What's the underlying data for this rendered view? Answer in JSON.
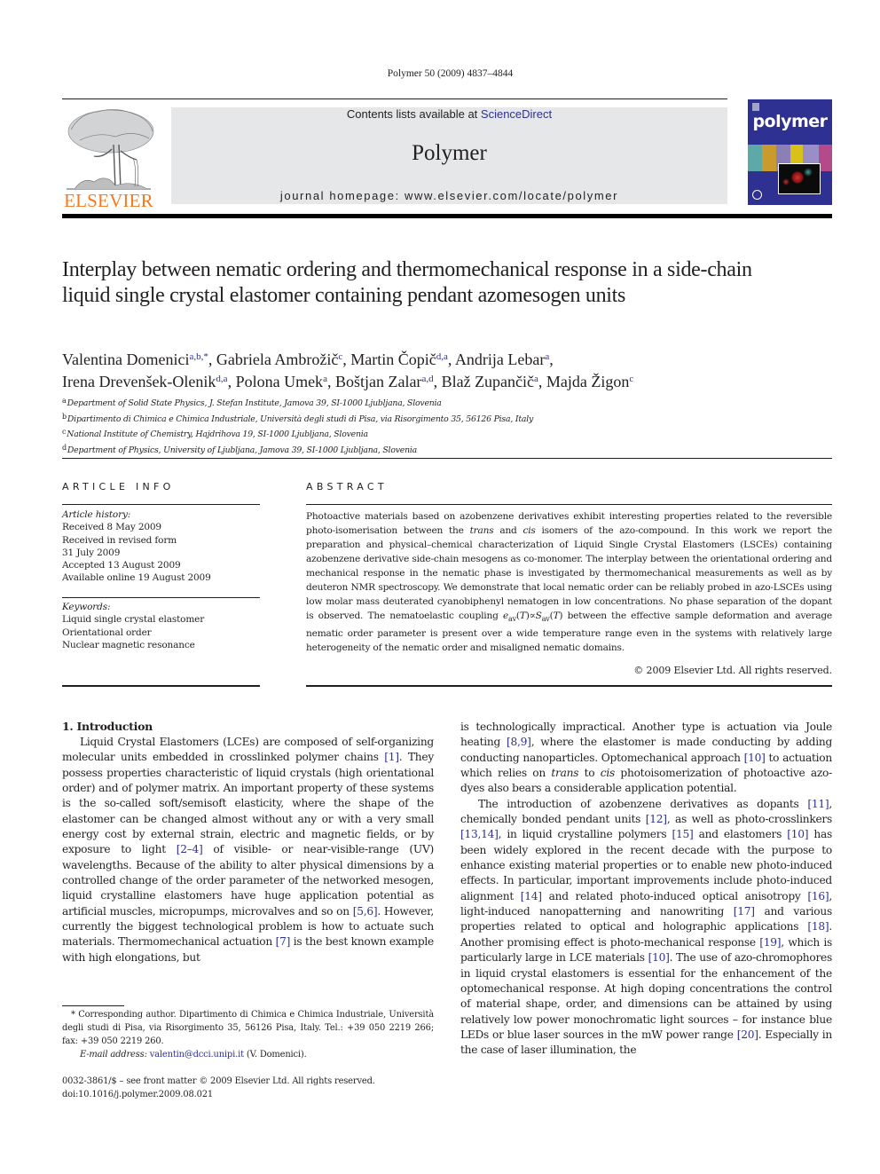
{
  "header": {
    "citation": "Polymer 50 (2009) 4837–4844",
    "contents_prefix": "Contents lists available at ",
    "contents_link": "ScienceDirect",
    "journal_name": "Polymer",
    "homepage": "journal homepage: www.elsevier.com/locate/polymer",
    "publisher_logo_text": "ELSEVIER",
    "cover_title": "polymer"
  },
  "colors": {
    "link": "#2e3192",
    "elsevier_orange": "#f47920",
    "banner_gray": "#e6e7e8",
    "cover_blue": "#2e3192"
  },
  "article": {
    "title": "Interplay between nematic ordering and thermomechanical response in a side-chain liquid single crystal elastomer containing pendant azomesogen units",
    "authors": [
      {
        "name": "Valentina Domenici",
        "aff": "a,b,*"
      },
      {
        "name": "Gabriela Ambrožič",
        "aff": "c"
      },
      {
        "name": "Martin Čopič",
        "aff": "d,a"
      },
      {
        "name": "Andrija Lebar",
        "aff": "a"
      },
      {
        "name": "Irena Drevenšek-Olenik",
        "aff": "d,a"
      },
      {
        "name": "Polona Umek",
        "aff": "a"
      },
      {
        "name": "Boštjan Zalar",
        "aff": "a,d"
      },
      {
        "name": "Blaž Zupančič",
        "aff": "a"
      },
      {
        "name": "Majda Žigon",
        "aff": "c"
      }
    ],
    "affiliations": [
      {
        "key": "a",
        "text": "Department of Solid State Physics, J. Stefan Institute, Jamova 39, SI-1000 Ljubljana, Slovenia"
      },
      {
        "key": "b",
        "text": "Dipartimento di Chimica e Chimica Industriale, Università degli studi di Pisa, via Risorgimento 35, 56126 Pisa, Italy"
      },
      {
        "key": "c",
        "text": "National Institute of Chemistry, Hajdrihova 19, SI-1000 Ljubljana, Slovenia"
      },
      {
        "key": "d",
        "text": "Department of Physics, University of Ljubljana, Jamova 39, SI-1000 Ljubljana, Slovenia"
      }
    ]
  },
  "article_info": {
    "heading": "ARTICLE INFO",
    "history_label": "Article history:",
    "history": [
      "Received 8 May 2009",
      "Received in revised form",
      "31 July 2009",
      "Accepted 13 August 2009",
      "Available online 19 August 2009"
    ],
    "keywords_label": "Keywords:",
    "keywords": [
      "Liquid single crystal elastomer",
      "Orientational order",
      "Nuclear magnetic resonance"
    ]
  },
  "abstract": {
    "heading": "ABSTRACT",
    "p1": "Photoactive materials based on azobenzene derivatives exhibit interesting properties related to the reversible photo-isomerisation between the ",
    "trans": "trans",
    "p2": " and ",
    "cis": "cis",
    "p3": " isomers of the azo-compound. In this work we report the preparation and physical–chemical characterization of Liquid Single Crystal Elastomers (LSCEs) containing azobenzene derivative side-chain mesogens as co-monomer. The interplay between the orientational ordering and mechanical response in the nematic phase is investigated by thermomechanical measurements as well as by deuteron NMR spectroscopy. We demonstrate that local nematic order can be reliably probed in azo-LSCEs using low molar mass deuterated cyanobiphenyl nematogen in low concentrations. No phase separation of the dopant is observed. The nematoelastic coupling ",
    "formula": "e_av(T) ∝ S_av(T)",
    "p4": " between the effective sample deformation and average nematic order parameter is present over a wide temperature range even in the systems with relatively large heterogeneity of the nematic order and misaligned nematic domains.",
    "copyright": "© 2009 Elsevier Ltd. All rights reserved."
  },
  "introduction": {
    "heading": "1.  Introduction",
    "left": [
      {
        "t": "Liquid Crystal Elastomers (LCEs) are composed of self-organizing molecular units embedded in crosslinked polymer chains "
      },
      {
        "r": "[1]"
      },
      {
        "t": ". They possess properties characteristic of liquid crystals (high orientational order) and of polymer matrix. An important property of these systems is the so-called soft/semisoft elasticity, where the shape of the elastomer can be changed almost without any or with a very small energy cost by external strain, electric and magnetic fields, or by exposure to light "
      },
      {
        "r": "[2–4]"
      },
      {
        "t": " of visible- or near-visible-range (UV) wavelengths. Because of the ability to alter physical dimensions by a controlled change of the order parameter of the networked mesogen, liquid crystalline elastomers have huge application potential as artificial muscles, micropumps, microvalves and so on "
      },
      {
        "r": "[5,6]"
      },
      {
        "t": ". However, currently the biggest technological problem is how to actuate such materials. Thermomechanical actuation "
      },
      {
        "r": "[7]"
      },
      {
        "t": " is the best known example with high elongations, but"
      }
    ],
    "right_p1": [
      {
        "t": "is technologically impractical. Another type is actuation via Joule heating "
      },
      {
        "r": "[8,9]"
      },
      {
        "t": ", where the elastomer is made conducting by adding conducting nanoparticles. Optomechanical approach "
      },
      {
        "r": "[10]"
      },
      {
        "t": " to actuation which relies on "
      },
      {
        "i": "trans"
      },
      {
        "t": " to "
      },
      {
        "i": "cis"
      },
      {
        "t": " photoisomerization of photoactive azo-dyes also bears a considerable application potential."
      }
    ],
    "right_p2": [
      {
        "t": "The introduction of azobenzene derivatives as dopants "
      },
      {
        "r": "[11]"
      },
      {
        "t": ", chemically bonded pendant units "
      },
      {
        "r": "[12]"
      },
      {
        "t": ", as well as photo-crosslinkers "
      },
      {
        "r": "[13,14]"
      },
      {
        "t": ", in liquid crystalline polymers "
      },
      {
        "r": "[15]"
      },
      {
        "t": " and elastomers "
      },
      {
        "r": "[10]"
      },
      {
        "t": " has been widely explored in the recent decade with the purpose to enhance existing material properties or to enable new photo-induced effects. In particular, important improvements include photo-induced alignment "
      },
      {
        "r": "[14]"
      },
      {
        "t": " and related photo-induced optical anisotropy "
      },
      {
        "r": "[16]"
      },
      {
        "t": ", light-induced nanopatterning and nanowriting "
      },
      {
        "r": "[17]"
      },
      {
        "t": " and various properties related to optical and holographic applications "
      },
      {
        "r": "[18]"
      },
      {
        "t": ". Another promising effect is photo-mechanical response "
      },
      {
        "r": "[19]"
      },
      {
        "t": ", which is particularly large in LCE materials "
      },
      {
        "r": "[10]"
      },
      {
        "t": ". The use of azo-chromophores in liquid crystal elastomers is essential for the enhancement of the optomechanical response. At high doping concentrations the control of material shape, order, and dimensions can be attained by using relatively low power monochromatic light sources – for instance blue LEDs or blue laser sources in the mW power range "
      },
      {
        "r": "[20]"
      },
      {
        "t": ". Especially in the case of laser illumination, the"
      }
    ]
  },
  "footnote": {
    "corresponding": "* Corresponding author. Dipartimento di Chimica e Chimica Industriale, Università degli studi di Pisa, via Risorgimento 35, 56126 Pisa, Italy. Tel.: +39 050 2219 266; fax: +39 050 2219 260.",
    "email_label": "E-mail address: ",
    "email": "valentin@dcci.unipi.it",
    "email_suffix": " (V. Domenici).",
    "issn_line": "0032-3861/$ – see front matter © 2009 Elsevier Ltd. All rights reserved.",
    "doi": "doi:10.1016/j.polymer.2009.08.021"
  }
}
